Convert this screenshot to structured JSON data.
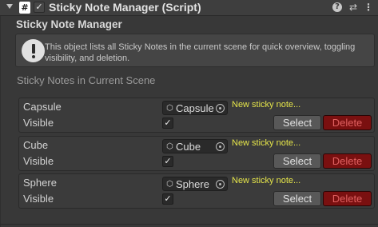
{
  "component": {
    "title": "Sticky Note Manager (Script)",
    "script_icon_glyph": "#",
    "enabled_check": "✓",
    "icons": [
      "help-icon",
      "presets-icon",
      "context-menu-icon"
    ],
    "help_glyph": "?",
    "presets_glyph": "⇄",
    "menu_glyph": "⋮"
  },
  "section_title": "Sticky Note Manager",
  "helpbox": {
    "icon": "info-icon",
    "text": "This object lists all Sticky Notes in the current scene for quick overview, toggling visibility, and deletion."
  },
  "list_title": "Sticky Notes in Current Scene",
  "items": [
    {
      "name": "Capsule",
      "object": "Capsule",
      "note": "New sticky note...",
      "visible_label": "Visible",
      "visible_check": "✓",
      "visible": true,
      "select_label": "Select",
      "delete_label": "Delete"
    },
    {
      "name": "Cube",
      "object": "Cube",
      "note": "New sticky note...",
      "visible_label": "Visible",
      "visible_check": "✓",
      "visible": true,
      "select_label": "Select",
      "delete_label": "Delete"
    },
    {
      "name": "Sphere",
      "object": "Sphere",
      "note": "New sticky note...",
      "visible_label": "Visible",
      "visible_check": "✓",
      "visible": true,
      "select_label": "Select",
      "delete_label": "Delete"
    }
  ],
  "colors": {
    "background": "#383838",
    "note_text": "#e5e54a",
    "delete_button": "#7a1010",
    "delete_text": "#e06060"
  }
}
